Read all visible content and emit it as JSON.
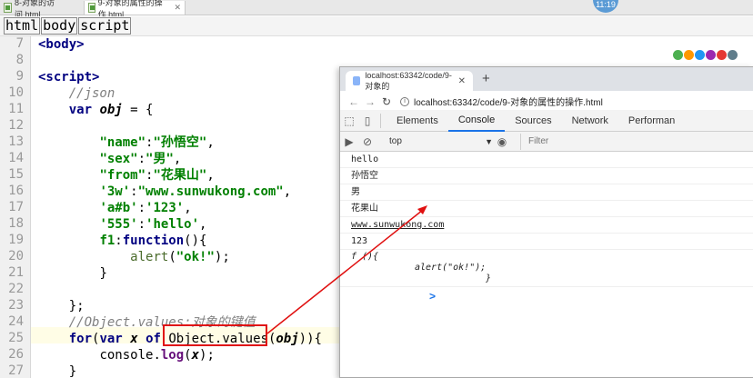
{
  "ide": {
    "tabs": [
      {
        "label": "8-对象的访问.html"
      },
      {
        "label": "9-对象的属性的操作.html"
      }
    ],
    "clock": "11:19",
    "breadcrumb": [
      "html",
      "body",
      "script"
    ],
    "line_numbers": [
      "7",
      "8",
      "9",
      "10",
      "11",
      "12",
      "13",
      "14",
      "15",
      "16",
      "17",
      "18",
      "19",
      "20",
      "21",
      "22",
      "23",
      "24",
      "25",
      "26",
      "27"
    ],
    "code": {
      "l7": "<body>",
      "l9": "<script>",
      "l10": "//json",
      "l11_kw": "var",
      "l11_var": "obj",
      "l11_rest": " = {",
      "l13_key": "\"name\"",
      "l13_val": "\"孙悟空\"",
      "l14_key": "\"sex\"",
      "l14_val": "\"男\"",
      "l15_key": "\"from\"",
      "l15_val": "\"花果山\"",
      "l16_key": "'3w'",
      "l16_val": "\"www.sunwukong.com\"",
      "l17_key": "'a#b'",
      "l17_val": "'123'",
      "l18_key": "'555'",
      "l18_val": "'hello'",
      "l19_name": "f1",
      "l19_kw": "function",
      "l19_rest": "(){",
      "l20_fn": "alert",
      "l20_str": "\"ok!\"",
      "l20_rest": ");",
      "l21": "}",
      "l23": "};",
      "l24": "//Object.values:对象的键值",
      "l25_for": "for",
      "l25_var": "var",
      "l25_x": "x",
      "l25_of": "of",
      "l25_call": "Object.values",
      "l25_obj": "obj",
      "l25_end": ")){",
      "l26_console": "console.",
      "l26_log": "log",
      "l26_x": "x",
      "l26_end": ");",
      "l27": "}"
    }
  },
  "browser": {
    "tab_title": "localhost:63342/code/9-对象的",
    "url": "localhost:63342/code/9-对象的属性的操作.html",
    "devtools_tabs": [
      "Elements",
      "Console",
      "Sources",
      "Network",
      "Performan"
    ],
    "active_tab": "Console",
    "context": "top",
    "filter_placeholder": "Filter",
    "console_lines": [
      "hello",
      "孙悟空",
      "男",
      "花果山",
      "www.sunwukong.com",
      "123"
    ],
    "fn_output": {
      "line1": "f (){",
      "line2": "alert(\"ok!\");",
      "line3": "}"
    },
    "prompt": ">"
  },
  "colors": {
    "annotation": "#e01010",
    "devtools_accent": "#1a73e8"
  }
}
